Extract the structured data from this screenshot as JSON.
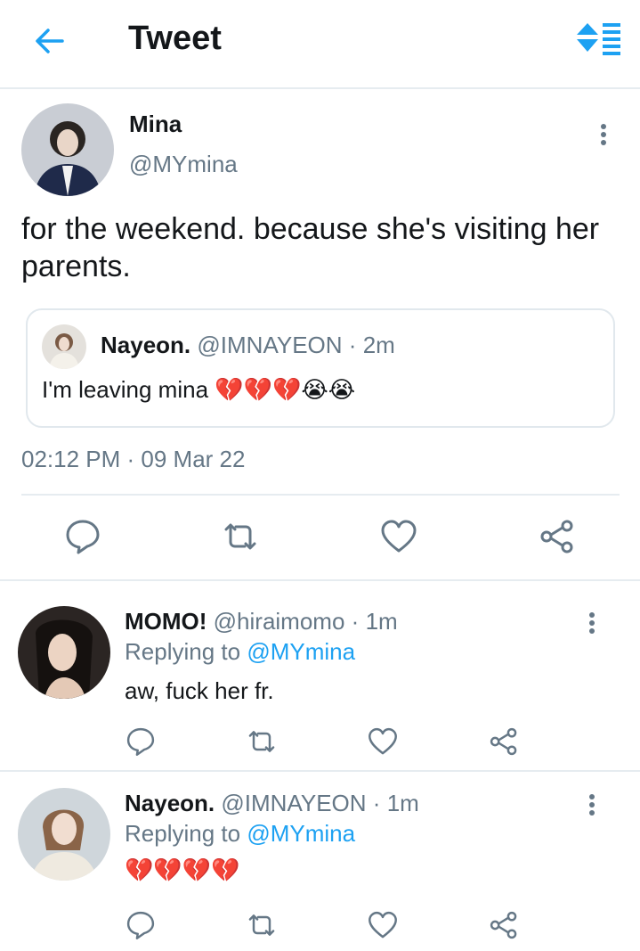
{
  "header": {
    "title": "Tweet",
    "back_icon": "arrow-left-icon",
    "sort_icon": "sort-icon",
    "accent_color": "#1da1f2"
  },
  "main_tweet": {
    "name": "Mina",
    "handle": "@MYmina",
    "text": "for the weekend. because she's visiting her parents.",
    "quoted": {
      "name": "Nayeon.",
      "handle": "@IMNAYEON",
      "separator": "·",
      "time": "2m",
      "text": "I'm leaving mina",
      "emojis": "💔💔💔😭😭"
    },
    "timestamp": "02:12 PM · 09 Mar 22",
    "actions": [
      "reply-icon",
      "retweet-icon",
      "like-icon",
      "share-icon"
    ]
  },
  "replies": [
    {
      "name": "MOMO!",
      "handle": "@hiraimomo",
      "separator": "·",
      "time": "1m",
      "replying_prefix": "Replying to",
      "replying_to": "@MYmina",
      "text": "aw, fuck her fr."
    },
    {
      "name": "Nayeon.",
      "handle": "@IMNAYEON",
      "separator": "·",
      "time": "1m",
      "replying_prefix": "Replying to",
      "replying_to": "@MYmina",
      "text": "💔💔💔💔"
    }
  ]
}
